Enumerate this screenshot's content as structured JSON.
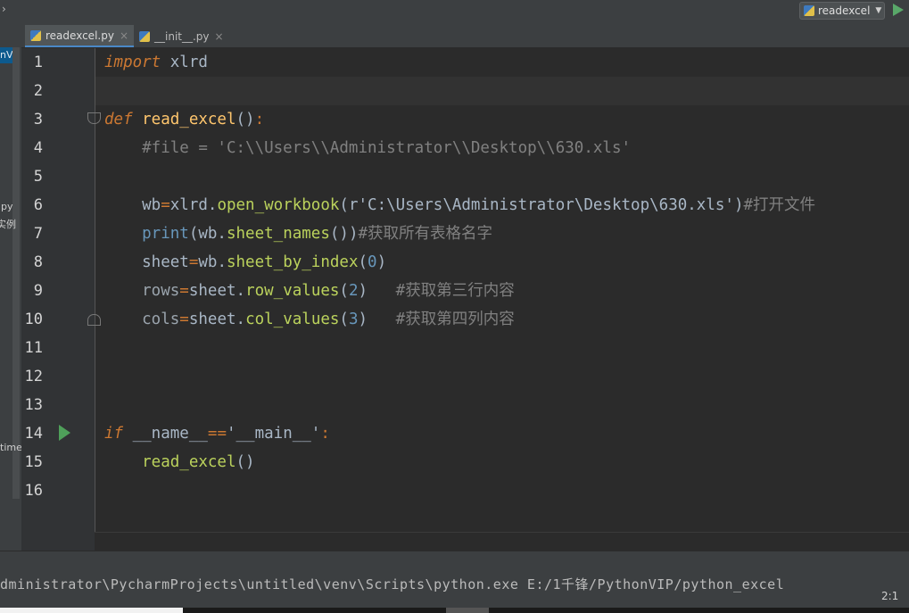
{
  "topbar": {
    "crumb": "›",
    "run_config": "readexcel"
  },
  "sidebar": {
    "selected": "nVIP",
    "labels": [
      "py",
      "实例",
      "time"
    ]
  },
  "tabs": [
    {
      "label": "readexcel.py",
      "active": true
    },
    {
      "label": "__init__.py",
      "active": false
    }
  ],
  "editor": {
    "line_numbers": [
      "1",
      "2",
      "3",
      "4",
      "5",
      "6",
      "7",
      "8",
      "9",
      "10",
      "11",
      "12",
      "13",
      "14",
      "15",
      "16"
    ],
    "code": {
      "l1_kw": "import",
      "l1_mod": " xlrd",
      "l3_kw": "def",
      "l3_fn": " read_excel",
      "l3_paren": "()",
      "l3_colon": ":",
      "l4_comment": "    #file = 'C:\\\\Users\\\\Administrator\\\\Desktop\\\\630.xls'",
      "l6_a": "    wb",
      "l6_eq": "=",
      "l6_b": "xlrd.",
      "l6_call": "open_workbook",
      "l6_c": "(",
      "l6_str": "r'C:\\Users\\Administrator\\Desktop\\630.xls'",
      "l6_d": ")",
      "l6_comment": "#打开文件",
      "l7_call": "    print",
      "l7_a": "(wb.",
      "l7_call2": "sheet_names",
      "l7_b": "())",
      "l7_comment": "#获取所有表格名字",
      "l8_a": "    sheet",
      "l8_eq": "=",
      "l8_b": "wb.",
      "l8_call": "sheet_by_index",
      "l8_c": "(",
      "l8_num": "0",
      "l8_d": ")",
      "l9_a": "    rows",
      "l9_eq": "=",
      "l9_b": "sheet.",
      "l9_call": "row_values",
      "l9_c": "(",
      "l9_num": "2",
      "l9_d": ")",
      "l9_comment": "   #获取第三行内容",
      "l10_a": "    cols",
      "l10_eq": "=",
      "l10_b": "sheet.",
      "l10_call": "col_values",
      "l10_c": "(",
      "l10_num": "3",
      "l10_d": ")",
      "l10_comment": "   #获取第四列内容",
      "l14_kw": "if",
      "l14_a": " __name__",
      "l14_eq": "==",
      "l14_str": "'__main__'",
      "l14_colon": ":",
      "l15_call": "    read_excel",
      "l15_a": "()"
    }
  },
  "status": {
    "path": "dministrator\\PycharmProjects\\untitled\\venv\\Scripts\\python.exe E:/1千锋/PythonVIP/python_excel",
    "position": "2:1"
  },
  "colors": {
    "background": "#2b2b2b",
    "gutter": "#313335",
    "keyword": "#cc7832",
    "function": "#ffc66d",
    "comment": "#808080",
    "number": "#6897bb",
    "string": "#6a8759",
    "run_green": "#59a869"
  }
}
